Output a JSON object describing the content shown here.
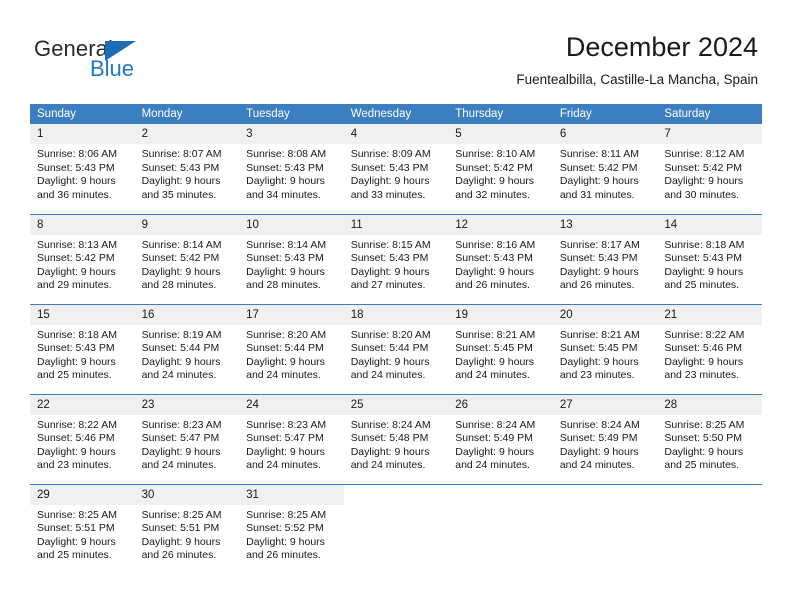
{
  "brand": {
    "word1": "General",
    "word2": "Blue",
    "triangle_color": "#1f6cb4",
    "blue_color": "#1f7ac4"
  },
  "header": {
    "title": "December 2024",
    "subtitle": "Fuentealbilla, Castille-La Mancha, Spain"
  },
  "theme": {
    "header_blue": "#3c7fc1",
    "daynum_gray": "#f0f0f0",
    "text": "#1a1a1a"
  },
  "calendar": {
    "weekday_headers": [
      "Sunday",
      "Monday",
      "Tuesday",
      "Wednesday",
      "Thursday",
      "Friday",
      "Saturday"
    ],
    "weeks": [
      [
        {
          "day": "1",
          "sunrise": "Sunrise: 8:06 AM",
          "sunset": "Sunset: 5:43 PM",
          "daylight1": "Daylight: 9 hours",
          "daylight2": "and 36 minutes."
        },
        {
          "day": "2",
          "sunrise": "Sunrise: 8:07 AM",
          "sunset": "Sunset: 5:43 PM",
          "daylight1": "Daylight: 9 hours",
          "daylight2": "and 35 minutes."
        },
        {
          "day": "3",
          "sunrise": "Sunrise: 8:08 AM",
          "sunset": "Sunset: 5:43 PM",
          "daylight1": "Daylight: 9 hours",
          "daylight2": "and 34 minutes."
        },
        {
          "day": "4",
          "sunrise": "Sunrise: 8:09 AM",
          "sunset": "Sunset: 5:43 PM",
          "daylight1": "Daylight: 9 hours",
          "daylight2": "and 33 minutes."
        },
        {
          "day": "5",
          "sunrise": "Sunrise: 8:10 AM",
          "sunset": "Sunset: 5:42 PM",
          "daylight1": "Daylight: 9 hours",
          "daylight2": "and 32 minutes."
        },
        {
          "day": "6",
          "sunrise": "Sunrise: 8:11 AM",
          "sunset": "Sunset: 5:42 PM",
          "daylight1": "Daylight: 9 hours",
          "daylight2": "and 31 minutes."
        },
        {
          "day": "7",
          "sunrise": "Sunrise: 8:12 AM",
          "sunset": "Sunset: 5:42 PM",
          "daylight1": "Daylight: 9 hours",
          "daylight2": "and 30 minutes."
        }
      ],
      [
        {
          "day": "8",
          "sunrise": "Sunrise: 8:13 AM",
          "sunset": "Sunset: 5:42 PM",
          "daylight1": "Daylight: 9 hours",
          "daylight2": "and 29 minutes."
        },
        {
          "day": "9",
          "sunrise": "Sunrise: 8:14 AM",
          "sunset": "Sunset: 5:42 PM",
          "daylight1": "Daylight: 9 hours",
          "daylight2": "and 28 minutes."
        },
        {
          "day": "10",
          "sunrise": "Sunrise: 8:14 AM",
          "sunset": "Sunset: 5:43 PM",
          "daylight1": "Daylight: 9 hours",
          "daylight2": "and 28 minutes."
        },
        {
          "day": "11",
          "sunrise": "Sunrise: 8:15 AM",
          "sunset": "Sunset: 5:43 PM",
          "daylight1": "Daylight: 9 hours",
          "daylight2": "and 27 minutes."
        },
        {
          "day": "12",
          "sunrise": "Sunrise: 8:16 AM",
          "sunset": "Sunset: 5:43 PM",
          "daylight1": "Daylight: 9 hours",
          "daylight2": "and 26 minutes."
        },
        {
          "day": "13",
          "sunrise": "Sunrise: 8:17 AM",
          "sunset": "Sunset: 5:43 PM",
          "daylight1": "Daylight: 9 hours",
          "daylight2": "and 26 minutes."
        },
        {
          "day": "14",
          "sunrise": "Sunrise: 8:18 AM",
          "sunset": "Sunset: 5:43 PM",
          "daylight1": "Daylight: 9 hours",
          "daylight2": "and 25 minutes."
        }
      ],
      [
        {
          "day": "15",
          "sunrise": "Sunrise: 8:18 AM",
          "sunset": "Sunset: 5:43 PM",
          "daylight1": "Daylight: 9 hours",
          "daylight2": "and 25 minutes."
        },
        {
          "day": "16",
          "sunrise": "Sunrise: 8:19 AM",
          "sunset": "Sunset: 5:44 PM",
          "daylight1": "Daylight: 9 hours",
          "daylight2": "and 24 minutes."
        },
        {
          "day": "17",
          "sunrise": "Sunrise: 8:20 AM",
          "sunset": "Sunset: 5:44 PM",
          "daylight1": "Daylight: 9 hours",
          "daylight2": "and 24 minutes."
        },
        {
          "day": "18",
          "sunrise": "Sunrise: 8:20 AM",
          "sunset": "Sunset: 5:44 PM",
          "daylight1": "Daylight: 9 hours",
          "daylight2": "and 24 minutes."
        },
        {
          "day": "19",
          "sunrise": "Sunrise: 8:21 AM",
          "sunset": "Sunset: 5:45 PM",
          "daylight1": "Daylight: 9 hours",
          "daylight2": "and 24 minutes."
        },
        {
          "day": "20",
          "sunrise": "Sunrise: 8:21 AM",
          "sunset": "Sunset: 5:45 PM",
          "daylight1": "Daylight: 9 hours",
          "daylight2": "and 23 minutes."
        },
        {
          "day": "21",
          "sunrise": "Sunrise: 8:22 AM",
          "sunset": "Sunset: 5:46 PM",
          "daylight1": "Daylight: 9 hours",
          "daylight2": "and 23 minutes."
        }
      ],
      [
        {
          "day": "22",
          "sunrise": "Sunrise: 8:22 AM",
          "sunset": "Sunset: 5:46 PM",
          "daylight1": "Daylight: 9 hours",
          "daylight2": "and 23 minutes."
        },
        {
          "day": "23",
          "sunrise": "Sunrise: 8:23 AM",
          "sunset": "Sunset: 5:47 PM",
          "daylight1": "Daylight: 9 hours",
          "daylight2": "and 24 minutes."
        },
        {
          "day": "24",
          "sunrise": "Sunrise: 8:23 AM",
          "sunset": "Sunset: 5:47 PM",
          "daylight1": "Daylight: 9 hours",
          "daylight2": "and 24 minutes."
        },
        {
          "day": "25",
          "sunrise": "Sunrise: 8:24 AM",
          "sunset": "Sunset: 5:48 PM",
          "daylight1": "Daylight: 9 hours",
          "daylight2": "and 24 minutes."
        },
        {
          "day": "26",
          "sunrise": "Sunrise: 8:24 AM",
          "sunset": "Sunset: 5:49 PM",
          "daylight1": "Daylight: 9 hours",
          "daylight2": "and 24 minutes."
        },
        {
          "day": "27",
          "sunrise": "Sunrise: 8:24 AM",
          "sunset": "Sunset: 5:49 PM",
          "daylight1": "Daylight: 9 hours",
          "daylight2": "and 24 minutes."
        },
        {
          "day": "28",
          "sunrise": "Sunrise: 8:25 AM",
          "sunset": "Sunset: 5:50 PM",
          "daylight1": "Daylight: 9 hours",
          "daylight2": "and 25 minutes."
        }
      ],
      [
        {
          "day": "29",
          "sunrise": "Sunrise: 8:25 AM",
          "sunset": "Sunset: 5:51 PM",
          "daylight1": "Daylight: 9 hours",
          "daylight2": "and 25 minutes."
        },
        {
          "day": "30",
          "sunrise": "Sunrise: 8:25 AM",
          "sunset": "Sunset: 5:51 PM",
          "daylight1": "Daylight: 9 hours",
          "daylight2": "and 26 minutes."
        },
        {
          "day": "31",
          "sunrise": "Sunrise: 8:25 AM",
          "sunset": "Sunset: 5:52 PM",
          "daylight1": "Daylight: 9 hours",
          "daylight2": "and 26 minutes."
        },
        {
          "day": "",
          "sunrise": "",
          "sunset": "",
          "daylight1": "",
          "daylight2": ""
        },
        {
          "day": "",
          "sunrise": "",
          "sunset": "",
          "daylight1": "",
          "daylight2": ""
        },
        {
          "day": "",
          "sunrise": "",
          "sunset": "",
          "daylight1": "",
          "daylight2": ""
        },
        {
          "day": "",
          "sunrise": "",
          "sunset": "",
          "daylight1": "",
          "daylight2": ""
        }
      ]
    ]
  }
}
